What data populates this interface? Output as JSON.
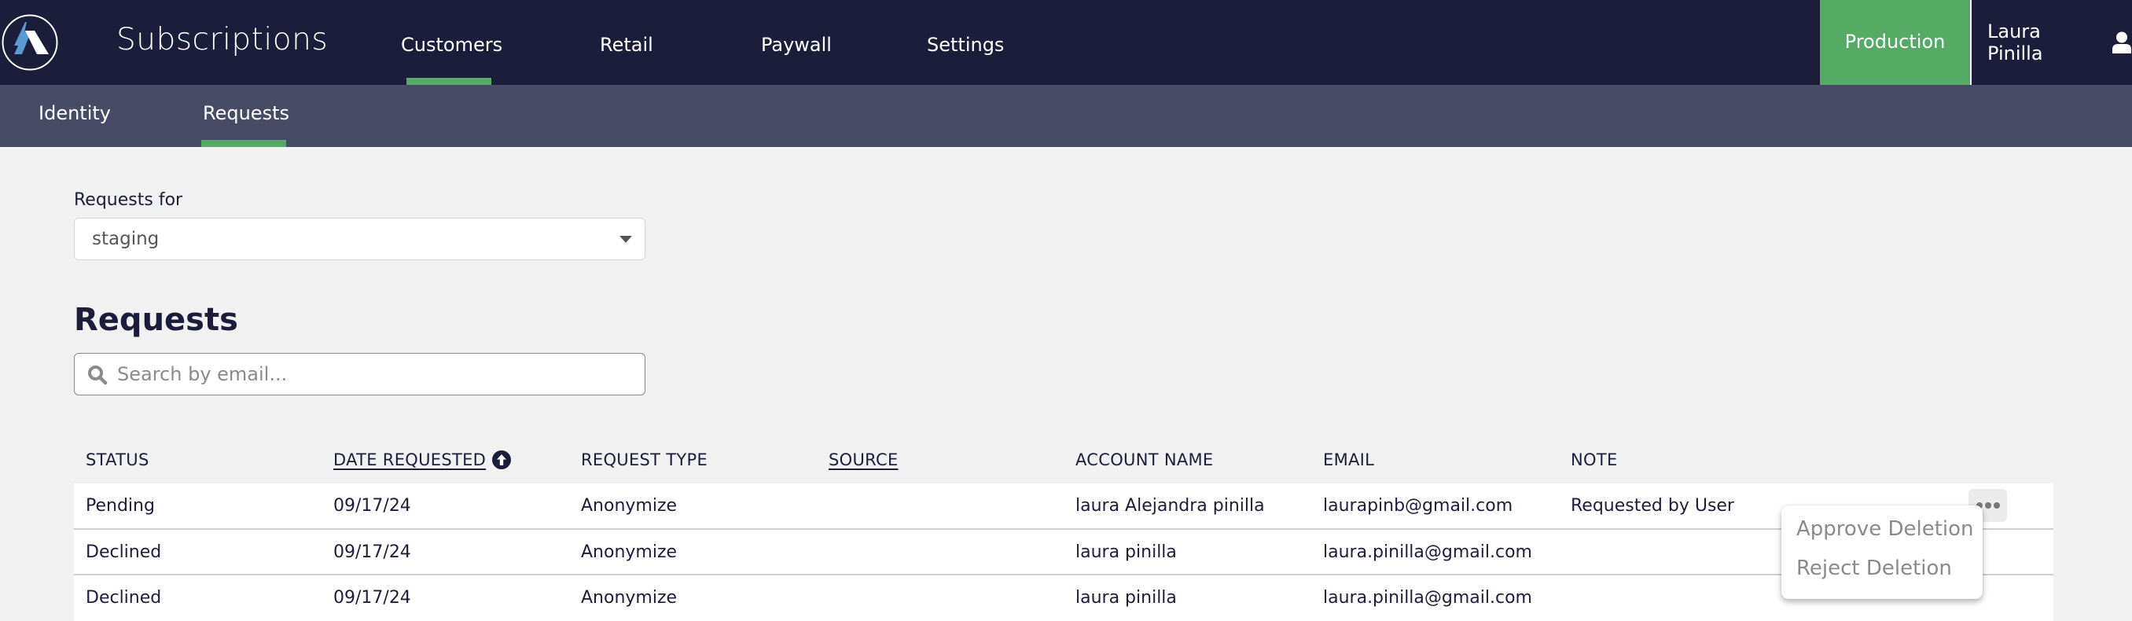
{
  "header": {
    "app_title": "Subscriptions",
    "nav": [
      {
        "label": "Customers",
        "active": true
      },
      {
        "label": "Retail",
        "active": false
      },
      {
        "label": "Paywall",
        "active": false
      },
      {
        "label": "Settings",
        "active": false
      }
    ],
    "environment_button": "Production",
    "user_name": "Laura Pinilla",
    "accent_color": "#55ab66"
  },
  "subnav": {
    "items": [
      {
        "label": "Identity",
        "active": false
      },
      {
        "label": "Requests",
        "active": true
      }
    ]
  },
  "filter": {
    "label": "Requests for",
    "selected": "staging"
  },
  "section_title": "Requests",
  "search": {
    "placeholder": "Search by email...",
    "value": ""
  },
  "table": {
    "columns": [
      {
        "label": "STATUS",
        "sortable": false
      },
      {
        "label": "DATE REQUESTED",
        "sortable": true,
        "sort": "ascending"
      },
      {
        "label": "REQUEST TYPE",
        "sortable": false
      },
      {
        "label": "SOURCE",
        "sortable": true
      },
      {
        "label": "ACCOUNT NAME",
        "sortable": false
      },
      {
        "label": "EMAIL",
        "sortable": false
      },
      {
        "label": "NOTE",
        "sortable": false
      }
    ],
    "rows": [
      {
        "status": "Pending",
        "date": "09/17/24",
        "type": "Anonymize",
        "source": "",
        "account": "laura Alejandra pinilla",
        "email": "laurapinb@gmail.com",
        "note": "Requested by User"
      },
      {
        "status": "Declined",
        "date": "09/17/24",
        "type": "Anonymize",
        "source": "",
        "account": "laura pinilla",
        "email": "laura.pinilla@gmail.com",
        "note": ""
      },
      {
        "status": "Declined",
        "date": "09/17/24",
        "type": "Anonymize",
        "source": "",
        "account": "laura pinilla",
        "email": "laura.pinilla@gmail.com",
        "note": ""
      }
    ]
  },
  "row_menu": {
    "items": [
      "Approve Deletion",
      "Reject Deletion"
    ]
  }
}
